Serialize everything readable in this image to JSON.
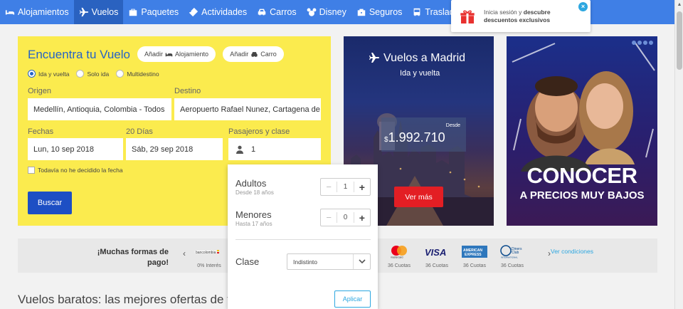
{
  "nav": {
    "items": [
      {
        "label": "Alojamientos",
        "icon": "bed-icon"
      },
      {
        "label": "Vuelos",
        "icon": "plane-icon",
        "active": true
      },
      {
        "label": "Paquetes",
        "icon": "suitcase-icon"
      },
      {
        "label": "Actividades",
        "icon": "ticket-icon"
      },
      {
        "label": "Carros",
        "icon": "car-icon"
      },
      {
        "label": "Disney",
        "icon": "mickey-icon"
      },
      {
        "label": "Seguros",
        "icon": "briefcase-icon"
      },
      {
        "label": "Traslados",
        "icon": "bus-icon"
      }
    ]
  },
  "login_popup": {
    "text_prefix": "Inicia sesión y ",
    "text_bold": "descubre descuentos exclusivos",
    "close": "×"
  },
  "search": {
    "title": "Encuentra tu Vuelo",
    "add_lodging": "Añadir",
    "add_lodging_suffix": "Alojamiento",
    "add_car": "Añadir",
    "add_car_suffix": "Carro",
    "trip_types": [
      "Ida y vuelta",
      "Solo ida",
      "Multidestino"
    ],
    "selected_trip": "Ida y vuelta",
    "origin_label": "Origen",
    "origin_value": "Medellín, Antioquia, Colombia - Todos",
    "destination_label": "Destino",
    "destination_value": "Aeropuerto Rafael Nunez, Cartagena de",
    "dates_label": "Fechas",
    "days_label": "20 Días",
    "date_from": "Lun, 10 sep 2018",
    "date_to": "Sáb, 29 sep 2018",
    "pax_label": "Pasajeros y clase",
    "pax_value": "1",
    "undecided_label": "Todavía no he decidido la fecha",
    "search_button": "Buscar"
  },
  "pax_dropdown": {
    "adults_label": "Adultos",
    "adults_sub": "Desde 18 años",
    "adults_value": "1",
    "minors_label": "Menores",
    "minors_sub": "Hasta 17 años",
    "minors_value": "0",
    "class_label": "Clase",
    "class_value": "Indistinto",
    "apply_button": "Aplicar"
  },
  "banner_madrid": {
    "title": "Vuelos a Madrid",
    "subtitle": "Ida y vuelta",
    "desde": "Desde",
    "currency": "$",
    "price": "1.992.710",
    "button": "Ver más"
  },
  "banner_promo": {
    "title": "CONOCER",
    "subtitle": "A PRECIOS MUY BAJOS"
  },
  "payments": {
    "title": "¡Muchas formas de pago!",
    "cards": [
      {
        "name": "Bancolombia",
        "caption": "0% Interés"
      },
      {
        "name": "Mastercard",
        "caption": "36 Cuotas"
      },
      {
        "name": "VISA",
        "caption": "36 Cuotas"
      },
      {
        "name": "American Express",
        "caption": "36 Cuotas"
      },
      {
        "name": "Diners Club",
        "caption": "36 Cuotas"
      }
    ],
    "link": "Ver condiciones"
  },
  "footer_title": "Vuelos baratos: las mejores ofertas de t"
}
